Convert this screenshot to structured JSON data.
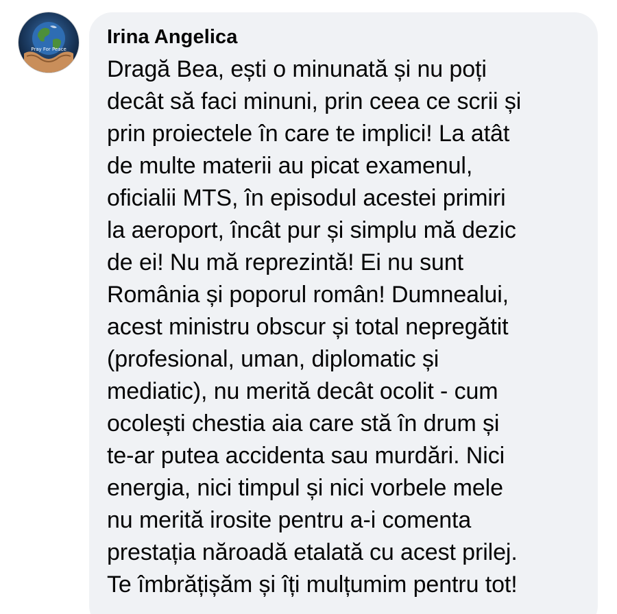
{
  "comment": {
    "author": "Irina Angelica",
    "avatar_icon": "earth-in-hands-icon",
    "avatar_caption": "Pray For Peace",
    "lines": [
      "Dragă Bea, ești o minunată și nu poți",
      "decât să faci minuni, prin ceea ce scrii și",
      "prin proiectele în care te implici! La atât",
      "de multe materii au picat examenul,",
      "oficialii MTS, în episodul acestei primiri",
      "la aeroport, încât pur și simplu mă dezic",
      "de ei! Nu mă reprezintă! Ei nu sunt",
      "România și poporul român! Dumnealui,",
      "acest ministru obscur și total nepregătit",
      "(profesional, uman, diplomatic și",
      "mediatic), nu merită decât ocolit - cum",
      "ocolești chestia aia care stă în drum și",
      "te-ar putea accidenta sau murdări. Nici",
      "energia, nici timpul și nici vorbele mele",
      "nu merită irosite pentru a-i comenta",
      "prestația năroadă etalată cu acest prilej.",
      "Te îmbrățișăm și îți mulțumim pentru tot!"
    ]
  },
  "colors": {
    "bubble_background": "#f0f2f5",
    "text": "#050505"
  }
}
